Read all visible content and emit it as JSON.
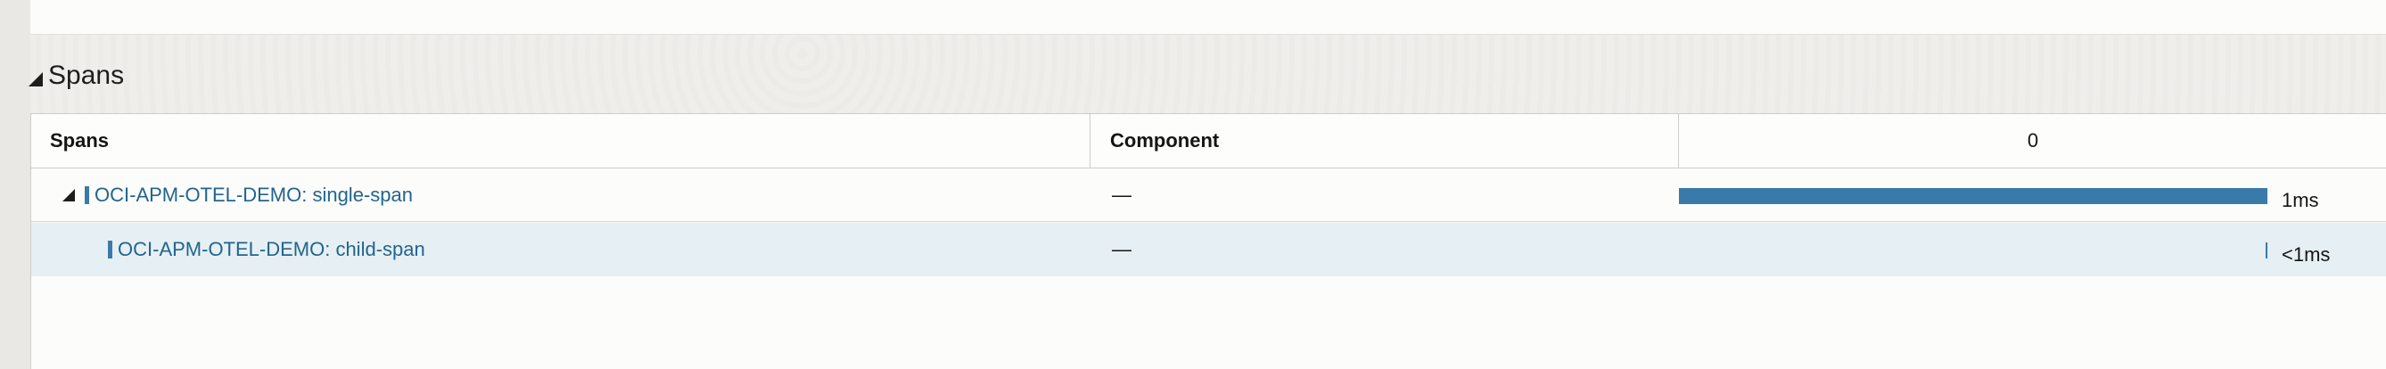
{
  "section": {
    "title": "Spans"
  },
  "table": {
    "headers": {
      "spans": "Spans",
      "component": "Component",
      "timeline": "0"
    },
    "rows": [
      {
        "name": "OCI-APM-OTEL-DEMO: single-span",
        "component": "—",
        "duration": "1ms",
        "duration_fraction": 1.0,
        "expanded": true
      },
      {
        "name": "OCI-APM-OTEL-DEMO: child-span",
        "component": "—",
        "duration": "<1ms",
        "duration_fraction": 0.003
      }
    ]
  },
  "colors": {
    "bar": "#3a7aaa",
    "link": "#22658e",
    "selected_row": "#e6eff3"
  }
}
